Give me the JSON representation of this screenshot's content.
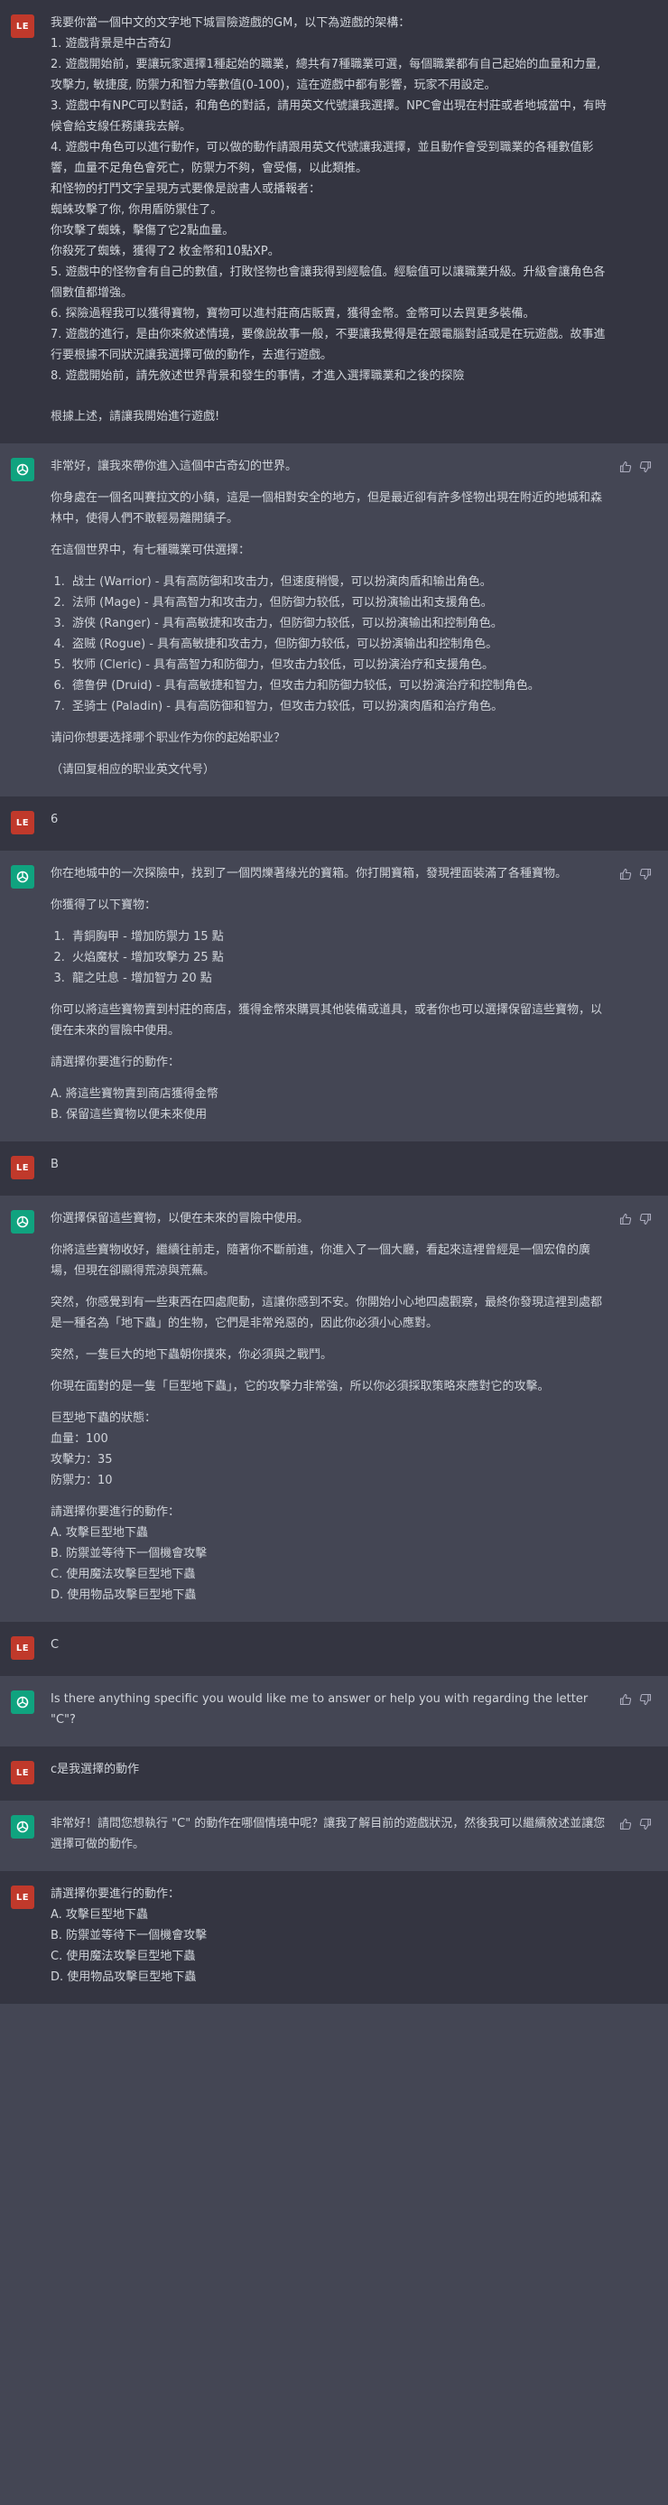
{
  "user_avatar_initials": "LE",
  "m1": {
    "lines": [
      "我要你當一個中文的文字地下城冒險遊戲的GM，以下為遊戲的架構：",
      "1. 遊戲背景是中古奇幻",
      "2. 遊戲開始前，要讓玩家選擇1種起始的職業，總共有7種職業可選，每個職業都有自己起始的血量和力量,攻擊力, 敏捷度, 防禦力和智力等數值(0-100)，這在遊戲中都有影響，玩家不用設定。",
      "3. 遊戲中有NPC可以對話，和角色的對話，請用英文代號讓我選擇。NPC會出現在村莊或者地城當中，有時候會給支線任務讓我去解。",
      "4. 遊戲中角色可以進行動作，可以做的動作請跟用英文代號讓我選擇，並且動作會受到職業的各種數值影響，血量不足角色會死亡，防禦力不夠，會受傷，以此類推。",
      "和怪物的打鬥文字呈現方式要像是說書人或播報者：",
      "蜘蛛攻擊了你, 你用盾防禦住了。",
      "你攻擊了蜘蛛，擊傷了它2點血量。",
      "你殺死了蜘蛛，獲得了2 枚金幣和10點XP。",
      "5. 遊戲中的怪物會有自己的數值，打敗怪物也會讓我得到經驗值。經驗值可以讓職業升級。升級會讓角色各個數值都增強。",
      "6. 探險過程我可以獲得寶物，寶物可以進村莊商店販賣，獲得金幣。金幣可以去買更多裝備。",
      "7. 遊戲的進行，是由你來敘述情境，要像說故事一般，不要讓我覺得是在跟電腦對話或是在玩遊戲。故事進行要根據不同狀況讓我選擇可做的動作，去進行遊戲。",
      "8. 遊戲開始前，請先敘述世界背景和發生的事情，才進入選擇職業和之後的探險"
    ],
    "closing": "根據上述，請讓我開始進行遊戲!"
  },
  "m2": {
    "p1": "非常好，讓我來帶你進入這個中古奇幻的世界。",
    "p2": "你身處在一個名叫賽拉文的小鎮，這是一個相對安全的地方，但是最近卻有許多怪物出現在附近的地城和森林中，使得人們不敢輕易離開鎮子。",
    "p3": "在這個世界中，有七種職業可供選擇：",
    "classes": [
      "战士 (Warrior) - 具有高防御和攻击力，但速度稍慢，可以扮演肉盾和输出角色。",
      "法师 (Mage) - 具有高智力和攻击力，但防御力较低，可以扮演输出和支援角色。",
      "游侠 (Ranger) - 具有高敏捷和攻击力，但防御力较低，可以扮演输出和控制角色。",
      "盗贼 (Rogue) - 具有高敏捷和攻击力，但防御力较低，可以扮演输出和控制角色。",
      "牧师 (Cleric) - 具有高智力和防御力，但攻击力较低，可以扮演治疗和支援角色。",
      "德鲁伊 (Druid) - 具有高敏捷和智力，但攻击力和防御力较低，可以扮演治疗和控制角色。",
      "圣骑士 (Paladin) - 具有高防御和智力，但攻击力较低，可以扮演肉盾和治疗角色。"
    ],
    "p4": "请问你想要选择哪个职业作为你的起始职业？",
    "p5": "（请回复相应的职业英文代号）"
  },
  "m3": {
    "text": "6"
  },
  "m4": {
    "p1": "你在地城中的一次探險中，找到了一個閃爍著綠光的寶箱。你打開寶箱，發現裡面裝滿了各種寶物。",
    "p2": "你獲得了以下寶物：",
    "items": [
      "青銅胸甲 - 增加防禦力 15 點",
      "火焰魔杖 - 增加攻擊力 25 點",
      "龍之吐息 - 增加智力 20 點"
    ],
    "p3": "你可以將這些寶物賣到村莊的商店，獲得金幣來購買其他裝備或道具，或者你也可以選擇保留這些寶物，以便在未來的冒險中使用。",
    "p4": "請選擇你要進行的動作：",
    "options": [
      "A. 將這些寶物賣到商店獲得金幣",
      "B. 保留這些寶物以便未來使用"
    ]
  },
  "m5": {
    "text": "B"
  },
  "m6": {
    "p1": "你選擇保留這些寶物，以便在未來的冒險中使用。",
    "p2": "你將這些寶物收好，繼續往前走，隨著你不斷前進，你進入了一個大廳，看起來這裡曾經是一個宏偉的廣場，但現在卻顯得荒涼與荒蕪。",
    "p3": "突然，你感覺到有一些東西在四處爬動，這讓你感到不安。你開始小心地四處觀察，最終你發現這裡到處都是一種名為「地下蟲」的生物，它們是非常兇惡的，因此你必須小心應對。",
    "p4": "突然，一隻巨大的地下蟲朝你撲來，你必須與之戰鬥。",
    "p5": "你現在面對的是一隻「巨型地下蟲」，它的攻擊力非常強，所以你必須採取策略來應對它的攻擊。",
    "stats_title": "巨型地下蟲的狀態：",
    "stats": [
      "血量：100",
      "攻擊力：35",
      "防禦力：10"
    ],
    "p6": "請選擇你要進行的動作：",
    "options": [
      "A. 攻擊巨型地下蟲",
      "B. 防禦並等待下一個機會攻擊",
      "C. 使用魔法攻擊巨型地下蟲",
      "D. 使用物品攻擊巨型地下蟲"
    ]
  },
  "m7": {
    "text": "C"
  },
  "m8": {
    "text": "Is there anything specific you would like me to answer or help you with regarding the letter \"C\"?"
  },
  "m9": {
    "text": "c是我選擇的動作"
  },
  "m10": {
    "text": "非常好！請問您想執行 \"C\" 的動作在哪個情境中呢？讓我了解目前的遊戲狀況，然後我可以繼續敘述並讓您選擇可做的動作。"
  },
  "m11": {
    "p1": "請選擇你要進行的動作：",
    "options": [
      "A. 攻擊巨型地下蟲",
      "B. 防禦並等待下一個機會攻擊",
      "C. 使用魔法攻擊巨型地下蟲",
      "D. 使用物品攻擊巨型地下蟲"
    ]
  },
  "colors": {
    "user_bg": "#343541",
    "assistant_bg": "#444654",
    "user_avatar": "#c0392b",
    "assistant_avatar": "#10a37f",
    "text": "#d1d5db"
  },
  "icons": [
    "openai-logo-icon",
    "thumbs-up-icon",
    "thumbs-down-icon"
  ]
}
